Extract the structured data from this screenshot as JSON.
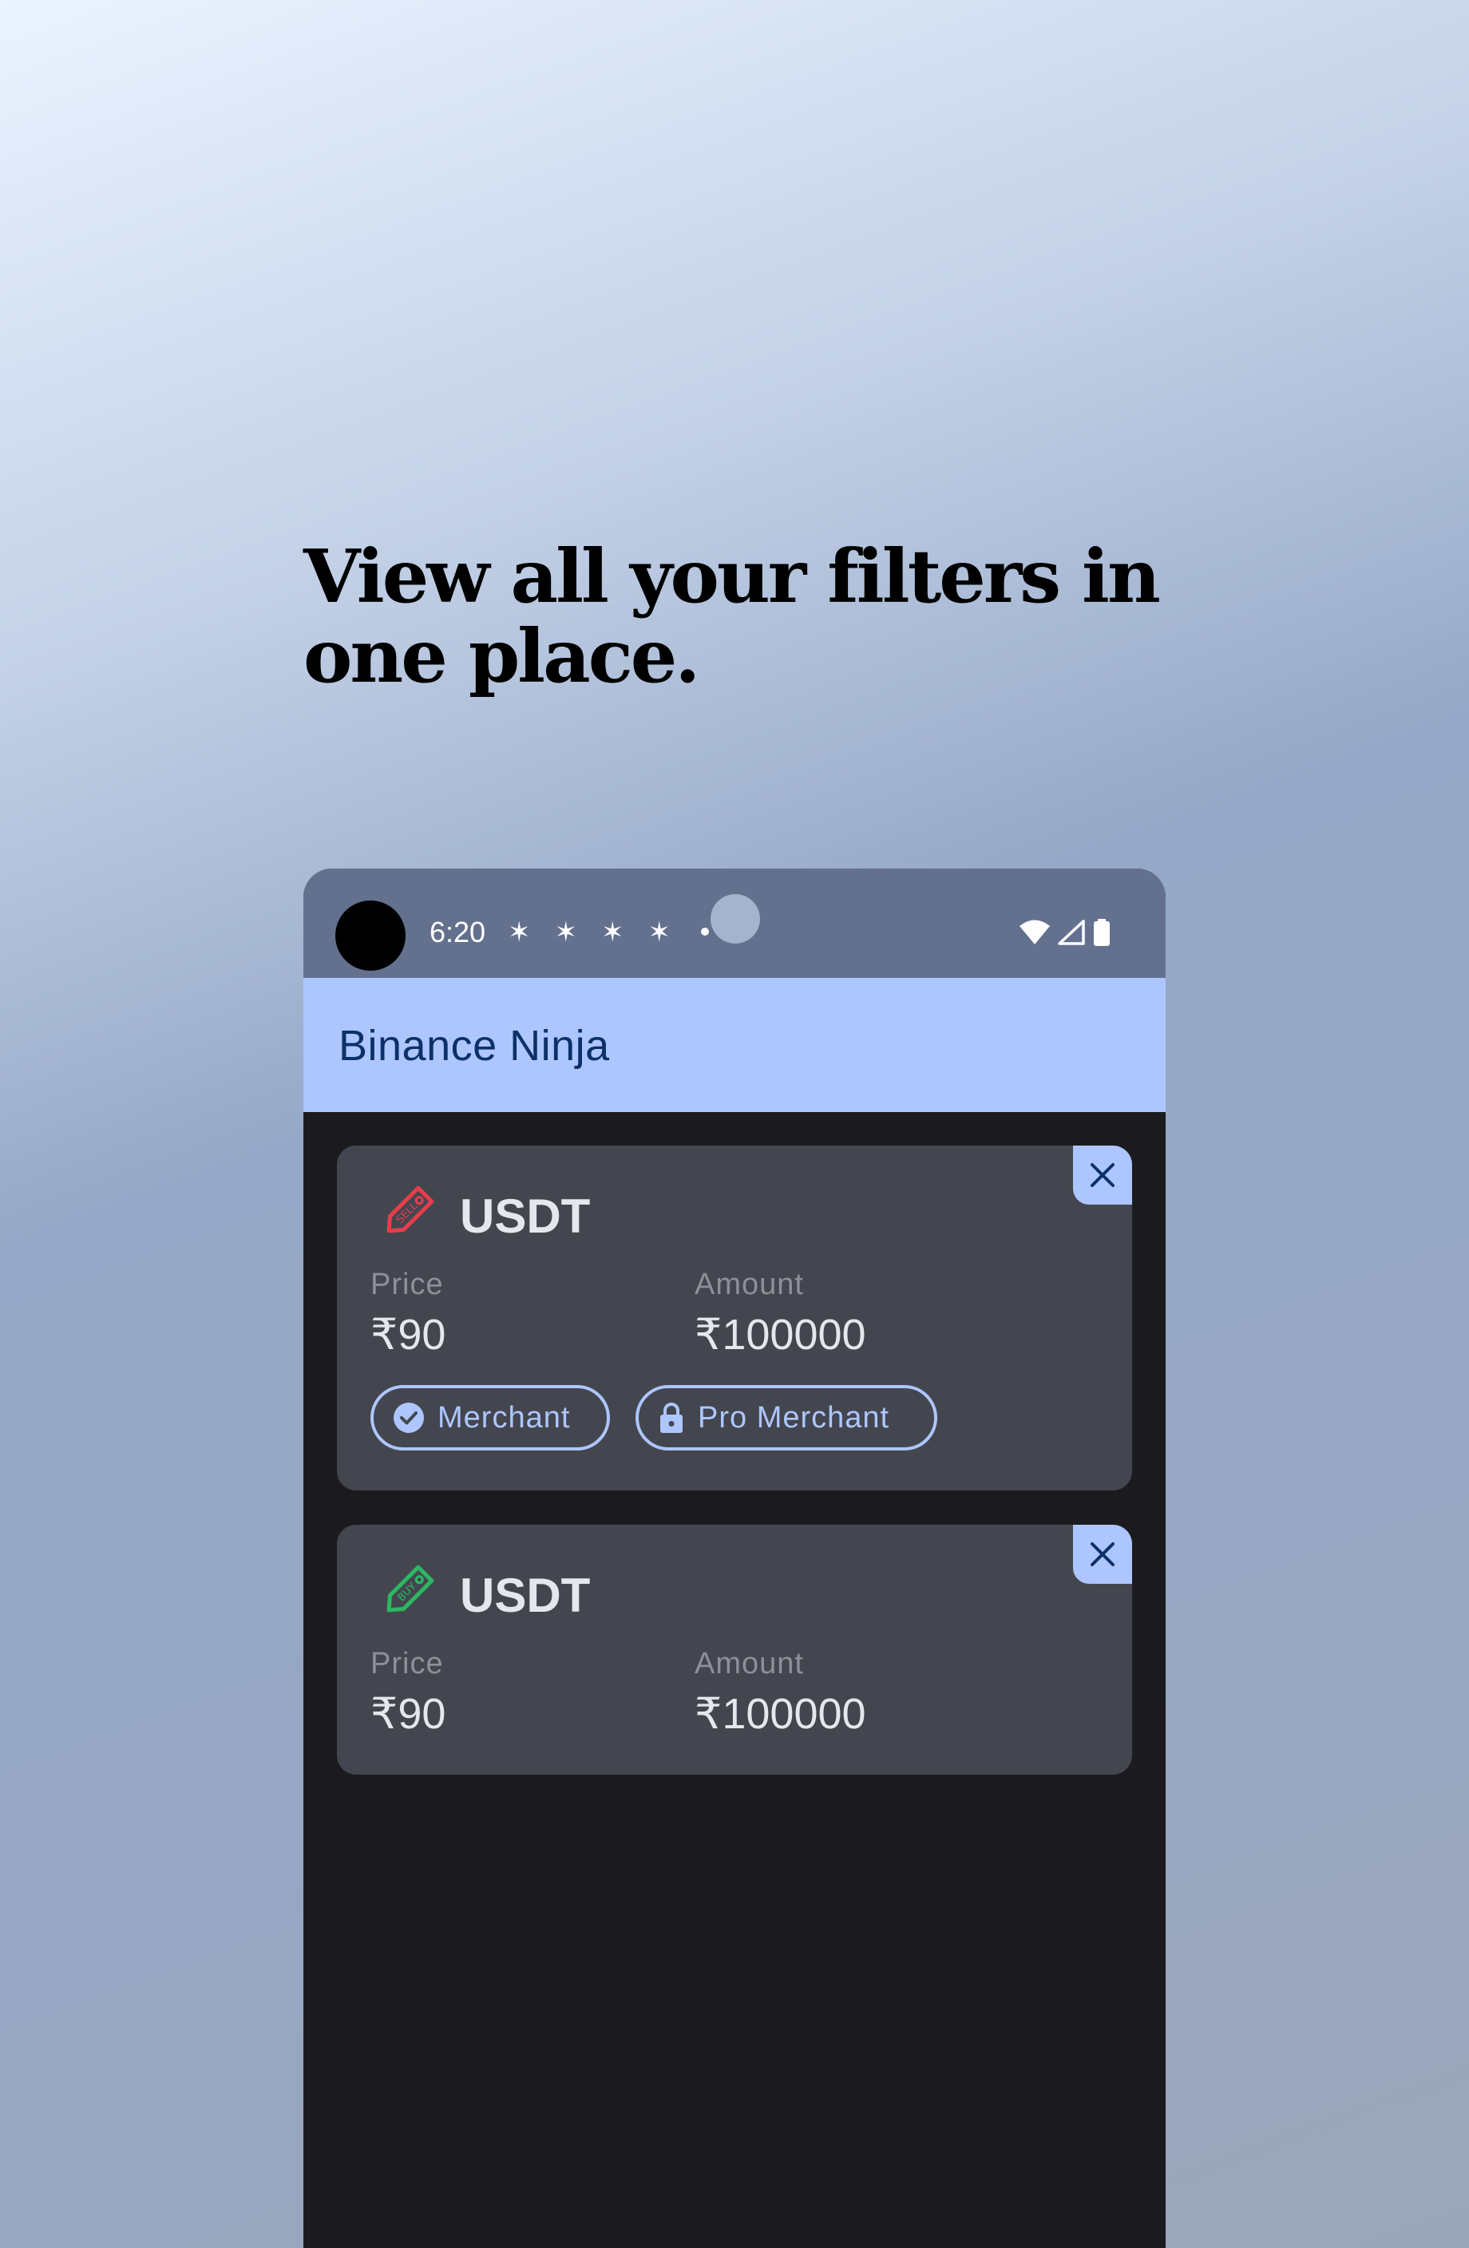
{
  "headline": "View all your filters in one place.",
  "status_bar": {
    "time": "6:20",
    "notification_icons": "✶✶✶✶"
  },
  "app_bar": {
    "title": "Binance Ninja"
  },
  "filters": [
    {
      "type": "SELL",
      "type_color": "#e53d4b",
      "coin": "USDT",
      "price_label": "Price",
      "price": "₹90",
      "amount_label": "Amount",
      "amount": "₹100000",
      "chips": [
        "Merchant",
        "Pro Merchant"
      ]
    },
    {
      "type": "BUY",
      "type_color": "#2bb863",
      "coin": "USDT",
      "price_label": "Price",
      "price": "₹90",
      "amount_label": "Amount",
      "amount": "₹100000",
      "chips": []
    }
  ],
  "colors": {
    "accent": "#adc6ff",
    "status_bar": "#63718f",
    "card": "#44464f",
    "background_dark": "#1b1b1f"
  }
}
